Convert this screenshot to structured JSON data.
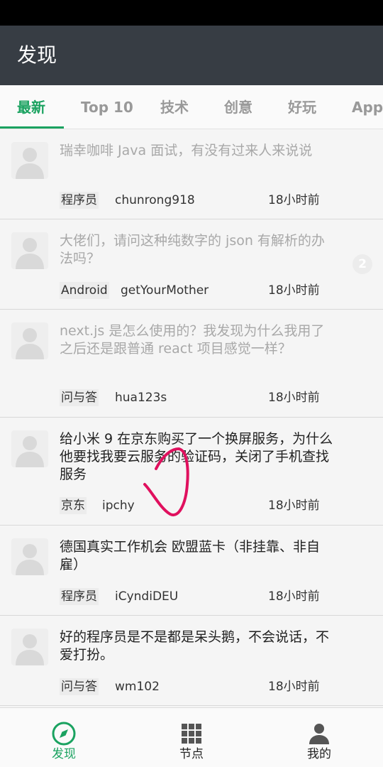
{
  "app": {
    "title": "发现"
  },
  "tabs": [
    {
      "label": "最新",
      "active": true
    },
    {
      "label": "Top 10",
      "active": false
    },
    {
      "label": "技术",
      "active": false
    },
    {
      "label": "创意",
      "active": false
    },
    {
      "label": "好玩",
      "active": false
    },
    {
      "label": "Apple",
      "active": false
    }
  ],
  "topics": [
    {
      "title": "瑞幸咖啡 Java 面试，有没有过来人来说说",
      "node": "程序员",
      "user": "chunrong918",
      "time": "18小时前",
      "read": true
    },
    {
      "title": "大佬们，请问这种纯数字的 json 有解析的办法吗？",
      "node": "Android",
      "user": "getYourMother",
      "time": "18小时前",
      "read": true,
      "replies": "2"
    },
    {
      "title": "next.js 是怎么使用的？我发现为什么我用了之后还是跟普通 react 项目感觉一样？",
      "node": "问与答",
      "user": "hua123s",
      "time": "18小时前",
      "read": true
    },
    {
      "title": "给小米 9 在京东购买了一个换屏服务，为什么他要找我要云服务的验证码，关闭了手机查找服务",
      "node": "京东",
      "user": "ipchy",
      "time": "18小时前",
      "read": false
    },
    {
      "title": "德国真实工作机会 欧盟蓝卡（非挂靠、非自雇）",
      "node": "程序员",
      "user": "iCyndiDEU",
      "time": "18小时前",
      "read": false
    },
    {
      "title": "好的程序员是不是都是呆头鹅，不会说话，不爱打扮。",
      "node": "问与答",
      "user": "wm102",
      "time": "18小时前",
      "read": false
    }
  ],
  "bottom_nav": [
    {
      "label": "发现",
      "icon": "compass-icon",
      "active": true
    },
    {
      "label": "节点",
      "icon": "grid-icon",
      "active": false
    },
    {
      "label": "我的",
      "icon": "person-icon",
      "active": false
    }
  ],
  "colors": {
    "accent": "#1aa260",
    "app_bar": "#373d44",
    "annotation": "#e0105e"
  }
}
